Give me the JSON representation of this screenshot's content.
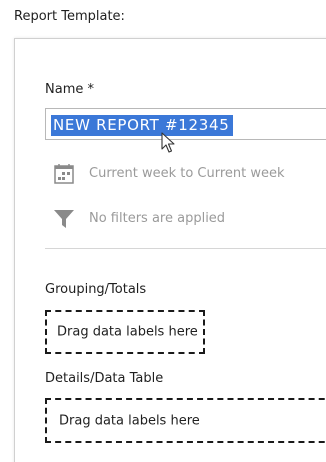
{
  "header": {
    "title": "Report Template:"
  },
  "form": {
    "name_label": "Name *",
    "name_value": "NEW REPORT #12345",
    "date_range_text": "Current week to Current week",
    "filters_text": "No filters are applied",
    "grouping_label": "Grouping/Totals",
    "grouping_drop_text": "Drag data labels here",
    "details_label": "Details/Data Table",
    "details_drop_text": "Drag data labels here"
  },
  "icons": {
    "calendar": "calendar-icon",
    "filter": "filter-icon",
    "cursor": "mouse-pointer-icon"
  },
  "colors": {
    "selection": "#3b78d8",
    "muted_text": "#9a9a9a",
    "icon_gray": "#8a8a8a"
  }
}
